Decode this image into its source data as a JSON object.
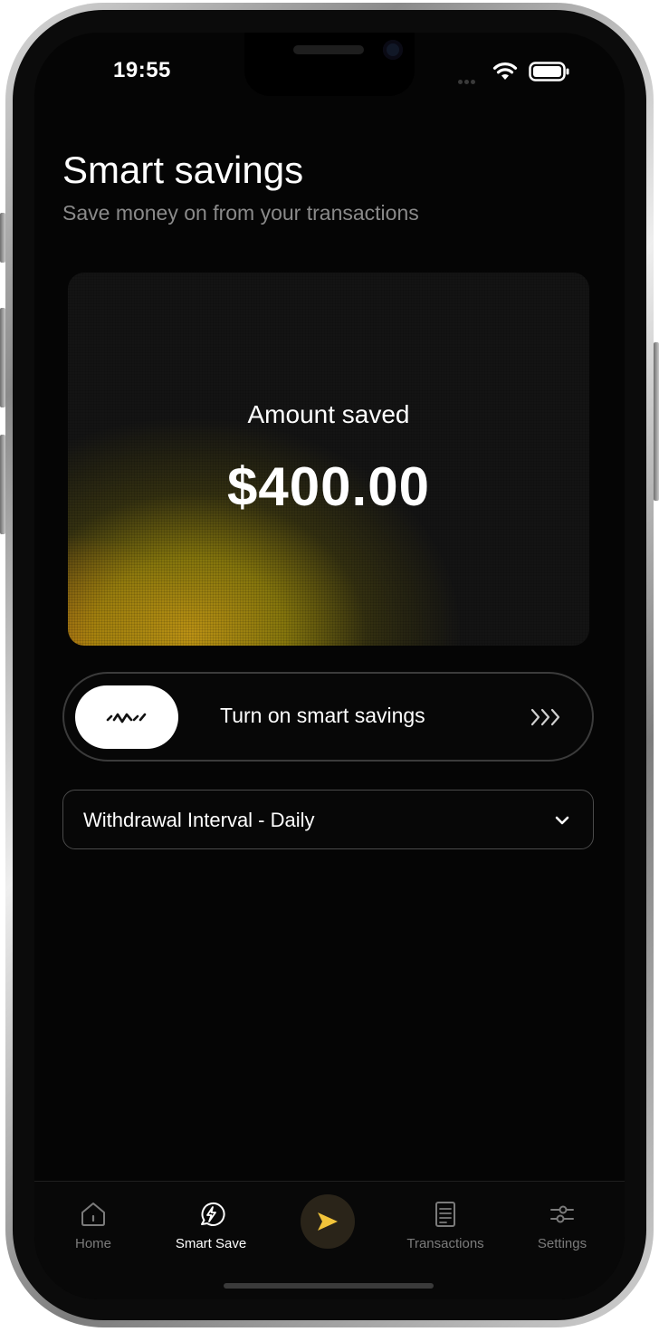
{
  "status_bar": {
    "time": "19:55"
  },
  "header": {
    "title": "Smart savings",
    "subtitle": "Save money on from your transactions"
  },
  "savings_card": {
    "label": "Amount saved",
    "amount": "$400.00"
  },
  "smart_toggle": {
    "label": "Turn on smart savings",
    "knob_icon": "squiggle-line-icon",
    "end_icon": "triple-chevron-right-icon"
  },
  "interval_select": {
    "selected": "Withdrawal Interval - Daily",
    "icon": "chevron-down-icon"
  },
  "bottom_nav": {
    "items": [
      {
        "label": "Home",
        "icon": "home-icon",
        "active": false
      },
      {
        "label": "Smart Save",
        "icon": "smart-save-icon",
        "active": true
      },
      {
        "label": "",
        "icon": "send-icon",
        "active": false
      },
      {
        "label": "Transactions",
        "icon": "document-icon",
        "active": false
      },
      {
        "label": "Settings",
        "icon": "sliders-icon",
        "active": false
      }
    ]
  },
  "colors": {
    "background": "#050505",
    "text_primary": "#ffffff",
    "text_secondary": "#8a8a8a",
    "accent": "#f2c43a",
    "card_glow": "#c4a012"
  }
}
